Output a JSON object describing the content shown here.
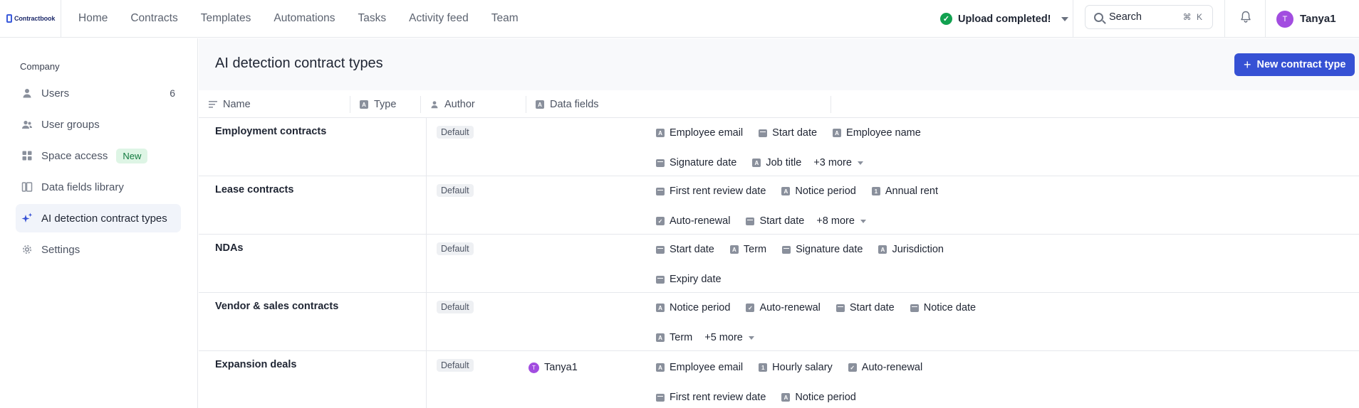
{
  "brand": {
    "logo_text": "Contractbook"
  },
  "nav": {
    "items": [
      "Home",
      "Contracts",
      "Templates",
      "Automations",
      "Tasks",
      "Activity feed",
      "Team"
    ]
  },
  "status": {
    "upload_text": "Upload completed!"
  },
  "search": {
    "label": "Search",
    "shortcut": "⌘ K"
  },
  "user": {
    "initial": "T",
    "name": "Tanya1"
  },
  "sidebar": {
    "heading": "Company",
    "items": [
      {
        "label": "Users",
        "count": "6"
      },
      {
        "label": "User groups"
      },
      {
        "label": "Space access",
        "badge": "New"
      },
      {
        "label": "Data fields library"
      },
      {
        "label": "AI detection contract types"
      },
      {
        "label": "Settings"
      }
    ]
  },
  "main": {
    "title": "AI detection contract types",
    "new_button": "New contract type",
    "columns": {
      "name": "Name",
      "type": "Type",
      "author": "Author",
      "data_fields": "Data fields"
    },
    "rows": [
      {
        "name": "Employment contracts",
        "type": "Default",
        "author": "",
        "fields": [
          {
            "icon": "text",
            "label": "Employee email"
          },
          {
            "icon": "date",
            "label": "Start date"
          },
          {
            "icon": "text",
            "label": "Employee name"
          },
          {
            "icon": "date",
            "label": "Signature date"
          },
          {
            "icon": "text",
            "label": "Job title"
          }
        ],
        "more": "+3 more"
      },
      {
        "name": "Lease contracts",
        "type": "Default",
        "author": "",
        "fields": [
          {
            "icon": "date",
            "label": "First rent review date"
          },
          {
            "icon": "text",
            "label": "Notice period"
          },
          {
            "icon": "number",
            "label": "Annual rent"
          },
          {
            "icon": "check",
            "label": "Auto-renewal"
          },
          {
            "icon": "date",
            "label": "Start date"
          }
        ],
        "more": "+8 more"
      },
      {
        "name": "NDAs",
        "type": "Default",
        "author": "",
        "fields": [
          {
            "icon": "date",
            "label": "Start date"
          },
          {
            "icon": "text",
            "label": "Term"
          },
          {
            "icon": "date",
            "label": "Signature date"
          },
          {
            "icon": "text",
            "label": "Jurisdiction"
          },
          {
            "icon": "date",
            "label": "Expiry date"
          }
        ],
        "more": ""
      },
      {
        "name": "Vendor & sales contracts",
        "type": "Default",
        "author": "",
        "fields": [
          {
            "icon": "text",
            "label": "Notice period"
          },
          {
            "icon": "check",
            "label": "Auto-renewal"
          },
          {
            "icon": "date",
            "label": "Start date"
          },
          {
            "icon": "date",
            "label": "Notice date"
          },
          {
            "icon": "text",
            "label": "Term"
          }
        ],
        "more": "+5 more"
      },
      {
        "name": "Expansion deals",
        "type": "Default",
        "author": "Tanya1",
        "author_initial": "T",
        "fields": [
          {
            "icon": "text",
            "label": "Employee email"
          },
          {
            "icon": "number",
            "label": "Hourly salary"
          },
          {
            "icon": "check",
            "label": "Auto-renewal"
          },
          {
            "icon": "date",
            "label": "First rent review date"
          },
          {
            "icon": "text",
            "label": "Notice period"
          }
        ],
        "more": ""
      }
    ]
  },
  "colors": {
    "accent": "#3651d4",
    "success": "#12a150",
    "avatar": "#a24de0",
    "badge_bg": "#def5e5",
    "badge_text": "#127a3f"
  }
}
